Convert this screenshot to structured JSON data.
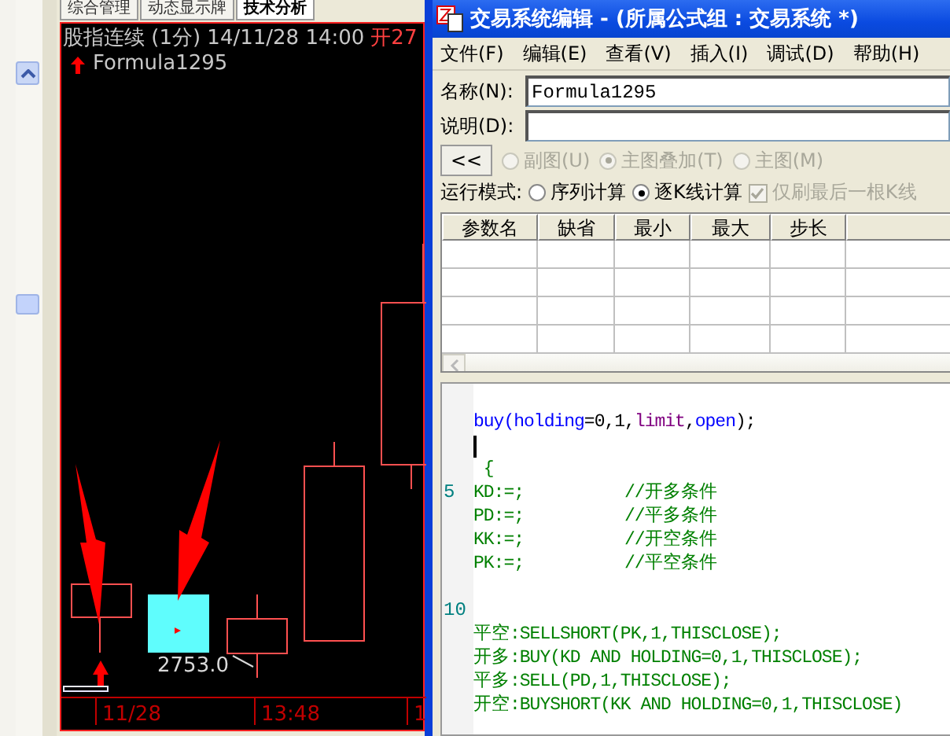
{
  "tabs": [
    {
      "label": "综合管理",
      "selected": false
    },
    {
      "label": "动态显示牌",
      "selected": false
    },
    {
      "label": "技术分析",
      "selected": true
    }
  ],
  "chart": {
    "title": "股指连续 (1分) 14/11/28 14:00",
    "open_label": "开27",
    "formula": "Formula1295",
    "price_label": "2753.0",
    "x_labels": [
      "11/28",
      "13:48",
      "1"
    ]
  },
  "dialog": {
    "title": "交易系统编辑 - (所属公式组 : 交易系统 *)",
    "menu": [
      "文件(F)",
      "编辑(E)",
      "查看(V)",
      "插入(I)",
      "调试(D)",
      "帮助(H)"
    ],
    "name_label": "名称(N):",
    "name_value": "Formula1295",
    "desc_label": "说明(D):",
    "collapse_button": "<<",
    "chart_type_options": [
      {
        "label": "副图(U)",
        "selected": false,
        "disabled": true
      },
      {
        "label": "主图叠加(T)",
        "selected": true,
        "disabled": true
      },
      {
        "label": "主图(M)",
        "selected": false,
        "disabled": true
      }
    ],
    "mode_label": "运行模式:",
    "mode_options": [
      {
        "label": "序列计算",
        "selected": false
      },
      {
        "label": "逐K线计算",
        "selected": true
      }
    ],
    "last_bar_checkbox": {
      "label": "仅刷最后一根K线",
      "checked": true,
      "disabled": true
    },
    "param_columns": [
      "参数名",
      "缺省",
      "最小",
      "最大",
      "步长"
    ],
    "code_lines": [
      {
        "kind": "blank"
      },
      {
        "segments": [
          {
            "text": "buy(",
            "kind": "keyword"
          },
          {
            "text": "holding",
            "kind": "keyword"
          },
          {
            "text": "=0,1,",
            "kind": "plain"
          },
          {
            "text": "limit",
            "kind": "variable"
          },
          {
            "text": ",",
            "kind": "plain"
          },
          {
            "text": "open",
            "kind": "keyword"
          },
          {
            "text": ");",
            "kind": "plain"
          }
        ]
      },
      {
        "kind": "cursor"
      },
      {
        "segments": [
          {
            "text": " {",
            "kind": "code"
          }
        ]
      },
      {
        "number": "5",
        "segments": [
          {
            "text": "KD:=;          //开多条件",
            "kind": "code"
          }
        ]
      },
      {
        "segments": [
          {
            "text": "PD:=;          //平多条件",
            "kind": "code"
          }
        ]
      },
      {
        "segments": [
          {
            "text": "KK:=;          //开空条件",
            "kind": "code"
          }
        ]
      },
      {
        "segments": [
          {
            "text": "PK:=;          //平空条件",
            "kind": "code"
          }
        ]
      },
      {
        "kind": "blank"
      },
      {
        "kind": "blank",
        "number": "10"
      },
      {
        "segments": [
          {
            "text": "平空:SELLSHORT(PK,1,THISCLOSE);",
            "kind": "code"
          }
        ]
      },
      {
        "segments": [
          {
            "text": "开多:BUY(KD AND HOLDING=0,1,THISCLOSE);",
            "kind": "code"
          }
        ]
      },
      {
        "segments": [
          {
            "text": "平多:SELL(PD,1,THISCLOSE);",
            "kind": "code"
          }
        ]
      },
      {
        "segments": [
          {
            "text": "开空:BUYSHORT(KK AND HOLDING=0,1,THISCLOSE)",
            "kind": "code"
          }
        ]
      }
    ]
  }
}
